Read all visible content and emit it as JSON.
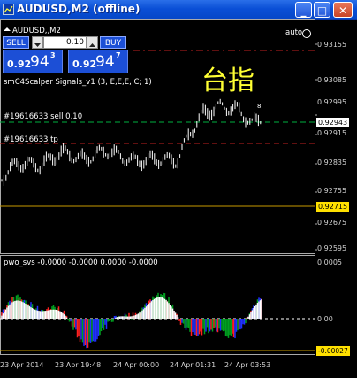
{
  "window": {
    "title": "AUDUSD,M2 (offline)",
    "buttons": {
      "minimize": "_",
      "maximize": "□",
      "close": "✕"
    }
  },
  "chart": {
    "symbol_label": "AUDUSD,,M2",
    "auto_label": "auto",
    "indicator_label": "smC4Scalper Signals_v1 (3, E,E,E, C; 1)",
    "order_sell_label": "#19616633 sell 0.10",
    "order_tp_label": "#19616633 tp",
    "small_digit_label": "8",
    "watermark_text": "台指",
    "price_labels": [
      "0.93155",
      "0.93085",
      "0.92995",
      "0.92915",
      "0.92835",
      "0.92755",
      "0.92675",
      "0.92595"
    ],
    "price_current": "0.92943",
    "price_low_line": "0.92715",
    "subwindow_label": "pwo_svs -0.0000 -0.0000 0.0000 -0.0000",
    "sub_labels": [
      "0.0005",
      "0.00"
    ],
    "sub_current": "-0.00027",
    "time_labels": [
      "23 Apr 2014",
      "23 Apr 19:48",
      "24 Apr 00:00",
      "24 Apr 01:31",
      "24 Apr 03:53"
    ]
  },
  "trading_panel": {
    "sell_label": "SELL",
    "buy_label": "BUY",
    "lot_value": "0.10",
    "sell_price": {
      "prefix": "0.92",
      "big": "94",
      "sup": "3"
    },
    "buy_price": {
      "prefix": "0.92",
      "big": "94",
      "sup": "7"
    }
  },
  "colors": {
    "candle": "#ffffff",
    "sell_line": "#00c040",
    "tp_line": "#d02020",
    "low_line": "#d0a000",
    "watermark": "#ffff33",
    "hist_blue": "#2030ff",
    "hist_red": "#ff2020",
    "hist_green": "#00a020"
  }
}
